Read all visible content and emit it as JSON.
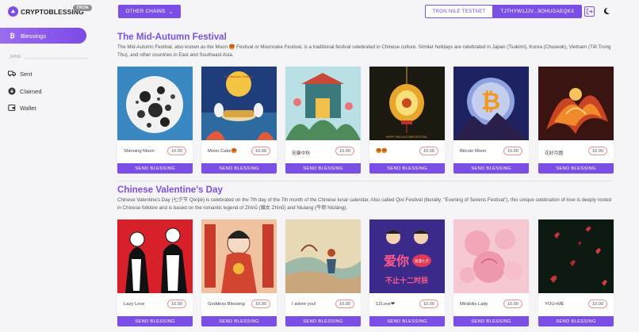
{
  "app": {
    "logo_text": "CRYPTOBLESSING",
    "logo_badge": "TRON"
  },
  "header": {
    "chains_label": "OTHER CHAINS",
    "network_label": "TRON NILE TESTNET",
    "address_label": "TJTHYW1JJV...9OHUGAEQKX"
  },
  "sidebar": {
    "active_item": "Blessings",
    "section_label": "MINE",
    "items": [
      "Sent",
      "Claimed",
      "Wallet"
    ]
  },
  "sections": [
    {
      "title": "The Mid-Autumn Festival",
      "description": "The Mid-Autumn Festival, also known as the Moon 🥮 Festival or Mooncake Festival, is a traditional festival celebrated in Chinese culture. Similar holidays are celebrated in Japan (Tsukimi), Korea (Chuseok), Vietnam (Tết Trung Thu), and other countries in East and Southeast Asia.",
      "cards": [
        {
          "name": "Shinning Moon",
          "price": "10.00",
          "button": "SEND BLESSING"
        },
        {
          "name": "Moon Cake🥮",
          "price": "10.00",
          "button": "SEND BLESSING"
        },
        {
          "name": "安康中秋",
          "price": "10.00",
          "button": "SEND BLESSING"
        },
        {
          "name": "🥮🥮",
          "price": "10.00",
          "button": "SEND BLESSING"
        },
        {
          "name": "Bitcoin Moon",
          "price": "10.00",
          "button": "SEND BLESSING"
        },
        {
          "name": "花好月圆",
          "price": "10.00",
          "button": "SEND BLESSING"
        }
      ]
    },
    {
      "title": "Chinese Valentine's Day",
      "description": "Chinese Valentine's Day (七夕节 Qixìjié) is celebrated on the 7th day of the 7th month of the Chinese lunar calendar. Also called Qixi Festival (literally: \"Evening of Sevens Festival\"), this unique celebration of love is deeply rooted in Chinese folklore and is based on the romantic legend of Zhīnǚ (織女 Zhīnǚ) and Niulang (牛郎 Niúláng).",
      "cards": [
        {
          "name": "Lazy Love",
          "price": "10.00",
          "button": "SEND BLESSING"
        },
        {
          "name": "Goddess Blessing",
          "price": "10.00",
          "button": "SEND BLESSING"
        },
        {
          "name": "I adore you!",
          "price": "10.00",
          "button": "SEND BLESSING"
        },
        {
          "name": "12Love❤",
          "price": "10.00",
          "button": "SEND BLESSING"
        },
        {
          "name": "Mirabilis Lady",
          "price": "10.00",
          "button": "SEND BLESSING"
        },
        {
          "name": "YOU+ME",
          "price": "10.00",
          "button": "SEND BLESSING"
        }
      ]
    }
  ],
  "art_text": {
    "mooncake_title": "Mid-Autumn Festival",
    "lantern_caption": "HAPPY MID-AUTUMN FESTIVAL",
    "qixi_big": "爱你",
    "qixi_line": "不止十二时辰",
    "qixi_tag": "浪漫七夕"
  },
  "colors": {
    "accent": "#7b4fe6",
    "price_border": "#e89393"
  }
}
